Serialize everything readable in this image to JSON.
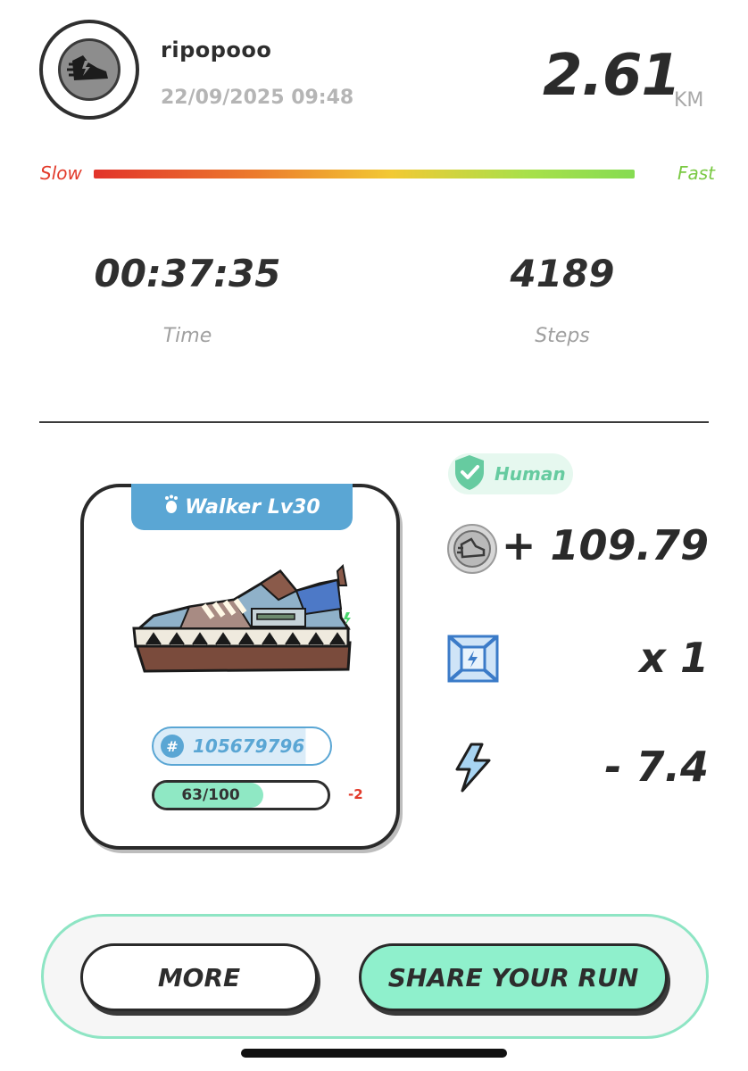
{
  "header": {
    "username": "ripopooo",
    "datetime": "22/09/2025 09:48",
    "distance": "2.61",
    "distance_unit": "KM"
  },
  "speed_bar": {
    "slow_label": "Slow",
    "fast_label": "Fast",
    "colors": [
      "#e2342b",
      "#ec7b2c",
      "#f2c934",
      "#a8e04a",
      "#86dc52"
    ]
  },
  "stats": {
    "time_value": "00:37:35",
    "time_label": "Time",
    "steps_value": "4189",
    "steps_label": "Steps"
  },
  "sneaker": {
    "type_level": "Walker Lv30",
    "id": "105679796",
    "id_symbol": "#",
    "durability_text": "63/100",
    "durability_fraction": 0.63,
    "durability_change": "-2",
    "accent_color": "#5aa6d4"
  },
  "rewards": {
    "verification": "Human",
    "earned": "+ 109.79",
    "multiplier": "x 1",
    "energy": "- 7.4"
  },
  "actions": {
    "more_label": "MORE",
    "share_label": "SHARE YOUR RUN"
  }
}
